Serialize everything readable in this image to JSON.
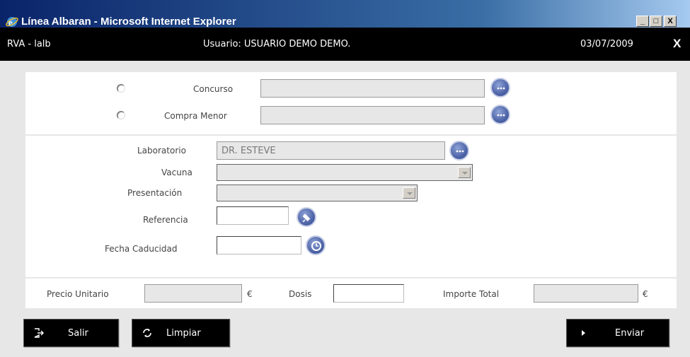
{
  "window": {
    "title": "Línea Albaran - Microsoft Internet Explorer",
    "minimize": "_",
    "maximize": "□",
    "close": "X"
  },
  "header": {
    "code": "RVA - lalb",
    "user": "Usuario: USUARIO DEMO DEMO.",
    "date": "03/07/2009",
    "close": "X"
  },
  "section1": {
    "concurso_label": "Concurso",
    "concurso_value": "",
    "compra_menor_label": "Compra Menor",
    "compra_menor_value": ""
  },
  "section2": {
    "laboratorio_label": "Laboratorio",
    "laboratorio_value": "DR. ESTEVE",
    "vacuna_label": "Vacuna",
    "vacuna_value": "",
    "presentacion_label": "Presentación",
    "presentacion_value": "",
    "referencia_label": "Referencia",
    "referencia_value": "",
    "fecha_label": "Fecha Caducidad",
    "fecha_value": ""
  },
  "section3": {
    "precio_label": "Precio Unitario",
    "precio_value": "",
    "currency": "€",
    "dosis_label": "Dosis",
    "dosis_value": "",
    "importe_label": "Importe Total",
    "importe_value": ""
  },
  "buttons": {
    "salir": "Salir",
    "limpiar": "Limpiar",
    "enviar": "Enviar"
  }
}
